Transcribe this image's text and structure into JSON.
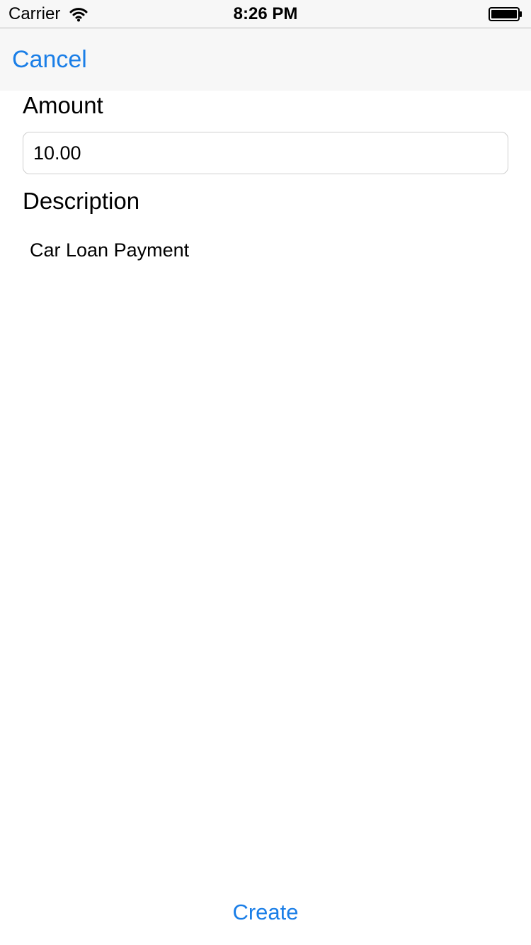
{
  "status_bar": {
    "carrier": "Carrier",
    "time": "8:26 PM",
    "wifi_icon": "wifi-icon",
    "battery_icon": "battery-icon"
  },
  "nav": {
    "cancel_label": "Cancel"
  },
  "form": {
    "amount_label": "Amount",
    "amount_value": "10.00",
    "description_label": "Description",
    "description_value": "Car Loan Payment"
  },
  "actions": {
    "create_label": "Create"
  },
  "colors": {
    "accent": "#1a7ee7",
    "nav_background": "#f7f7f7"
  }
}
